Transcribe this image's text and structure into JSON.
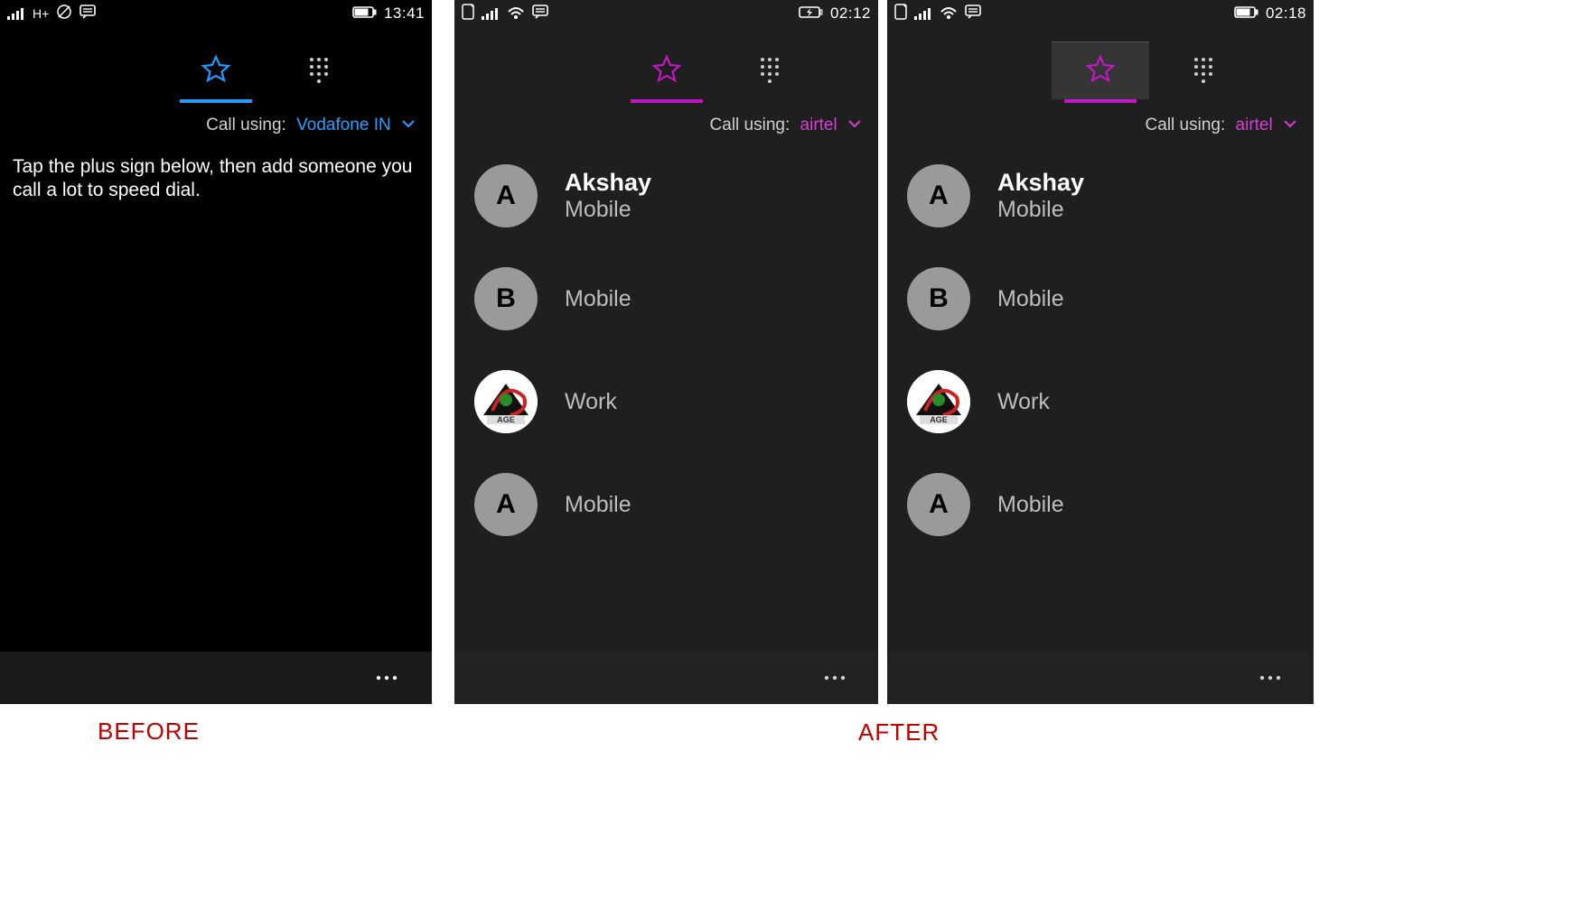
{
  "captions": {
    "before": "BEFORE",
    "after": "AFTER"
  },
  "phone1": {
    "status": {
      "left_text": "H+",
      "time": "13:41"
    },
    "callusing": {
      "label": "Call using:",
      "carrier": "Vodafone IN"
    },
    "instructions": "Tap the plus sign below, then add someone you call a lot to speed dial."
  },
  "phone2": {
    "status": {
      "time": "02:12"
    },
    "callusing": {
      "label": "Call using:",
      "carrier": "airtel"
    },
    "contacts": [
      {
        "initial": "A",
        "name": "Akshay",
        "type": "Mobile",
        "logo": false
      },
      {
        "initial": "B",
        "name": "",
        "type": "Mobile",
        "logo": false
      },
      {
        "initial": "",
        "name": "",
        "type": "Work",
        "logo": true
      },
      {
        "initial": "A",
        "name": "",
        "type": "Mobile",
        "logo": false
      }
    ]
  },
  "phone3": {
    "status": {
      "time": "02:18"
    },
    "callusing": {
      "label": "Call using:",
      "carrier": "airtel"
    },
    "contacts": [
      {
        "initial": "A",
        "name": "Akshay",
        "type": "Mobile",
        "logo": false
      },
      {
        "initial": "B",
        "name": "",
        "type": "Mobile",
        "logo": false
      },
      {
        "initial": "",
        "name": "",
        "type": "Work",
        "logo": true
      },
      {
        "initial": "A",
        "name": "",
        "type": "Mobile",
        "logo": false
      }
    ]
  }
}
